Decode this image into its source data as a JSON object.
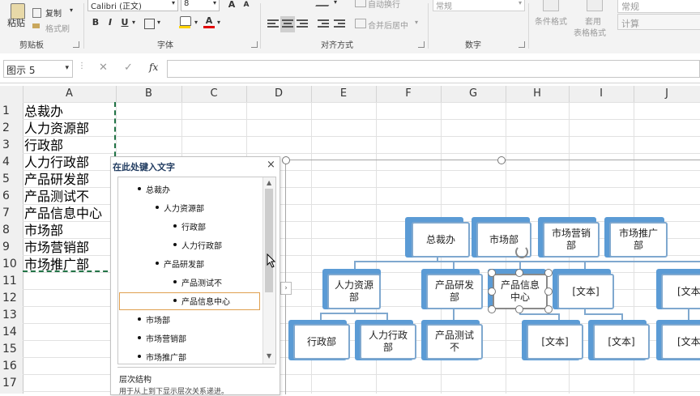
{
  "ribbon": {
    "clipboard": {
      "paste": "粘贴",
      "copy": "复制",
      "format_painter": "格式刷",
      "label": "剪贴板"
    },
    "font": {
      "name": "Calibri (正文)",
      "size": "8",
      "label": "字体",
      "increase": "A",
      "decrease": "A",
      "bold": "B",
      "italic": "I",
      "underline": "U",
      "font_color_glyph": "A"
    },
    "alignment": {
      "wrap": "自动换行",
      "merge": "合并后居中",
      "label": "对齐方式"
    },
    "number": {
      "format": "常规",
      "label": "数字"
    },
    "styles": {
      "conditional": "条件格式",
      "table_format_1": "套用",
      "table_format_2": "表格格式",
      "style_normal": "常规",
      "style_calc": "计算"
    }
  },
  "formula_bar": {
    "name_box": "图示 5",
    "fx": "fx",
    "cancel": "✕",
    "enter": "✓"
  },
  "columns": [
    "A",
    "B",
    "C",
    "D",
    "E",
    "F",
    "G",
    "H",
    "I",
    "J"
  ],
  "rows": [
    "1",
    "2",
    "3",
    "4",
    "5",
    "6",
    "7",
    "8",
    "9",
    "10",
    "11",
    "12",
    "13",
    "14",
    "15",
    "16",
    "17"
  ],
  "cells": [
    "总裁办",
    "人力资源部",
    "行政部",
    "人力行政部",
    "产品研发部",
    "产品测试不",
    "产品信息中心",
    "市场部",
    "市场营销部",
    "市场推广部"
  ],
  "text_pane": {
    "title": "在此处键入文字",
    "close": "×",
    "items": [
      {
        "text": "总裁办",
        "level": 1
      },
      {
        "text": "人力资源部",
        "level": 2
      },
      {
        "text": "行政部",
        "level": 3
      },
      {
        "text": "人力行政部",
        "level": 3
      },
      {
        "text": "产品研发部",
        "level": 2
      },
      {
        "text": "产品测试不",
        "level": 3
      },
      {
        "text": "产品信息中心",
        "level": 3
      },
      {
        "text": "市场部",
        "level": 1
      },
      {
        "text": "市场营销部",
        "level": 1
      },
      {
        "text": "市场推广部",
        "level": 1
      }
    ],
    "footer_title": "层次结构",
    "footer_desc": "用于从上到下显示层次关系递进。"
  },
  "smartart": {
    "top": [
      "总裁办",
      "市场部",
      "市场营销部",
      "市场推广部"
    ],
    "level2": [
      "人力资源部",
      "产品研发部",
      "产品信息中心",
      "[文本]",
      "[文本]"
    ],
    "level3": [
      "行政部",
      "人力行政部",
      "产品测试不",
      "[文本]",
      "[文本]",
      "[文本]"
    ]
  },
  "colors": {
    "node_border": "#7fa8cf",
    "node_back": "#5b9bd5",
    "connector": "#7fa8cf"
  }
}
